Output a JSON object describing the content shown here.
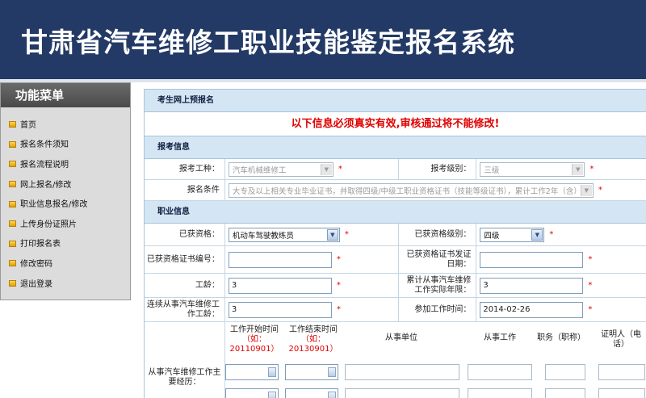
{
  "banner": {
    "title": "甘肃省汽车维修工职业技能鉴定报名系统"
  },
  "sidebar": {
    "title": "功能菜单",
    "items": [
      "首页",
      "报名条件须知",
      "报名流程说明",
      "网上报名/修改",
      "职业信息报名/修改",
      "上传身份证照片",
      "打印报名表",
      "修改密码",
      "退出登录"
    ]
  },
  "form": {
    "section_title": "考生网上预报名",
    "notice": "以下信息必须真实有效,审核通过将不能修改!",
    "exam_info": {
      "title": "报考信息",
      "job_label": "报考工种：",
      "job_value": "汽车机械维修工",
      "level_label": "报考级别：",
      "level_value": "三级",
      "condition_label": "报名条件",
      "condition_value": "大专及以上相关专业毕业证书，并取得四级/中级工职业资格证书（技能等级证书），累计工作2年（含）"
    },
    "job_info": {
      "title": "职业信息",
      "qual_label": "已获资格：",
      "qual_value": "机动车驾驶教练员",
      "qual_level_label": "已获资格级别：",
      "qual_level_value": "四级",
      "cert_no_label": "已获资格证书编号：",
      "cert_no_value": "",
      "cert_date_label": "已获资格证书发证日期：",
      "cert_date_value": "",
      "seniority_label": "工龄：",
      "seniority_value": "3",
      "years_label": "累计从事汽车维修工作实际年限：",
      "years_value": "3",
      "cont_years_label": "连续从事汽车维修工作工龄：",
      "cont_years_value": "3",
      "start_work_label": "参加工作时间：",
      "start_work_value": "2014-02-26"
    },
    "experience": {
      "label": "从事汽车维修工作主要经历：",
      "col_start": "工作开始时间",
      "col_start_hint": "（如：20110901）",
      "col_end": "工作结束时间",
      "col_end_hint": "（如：20130901）",
      "col_unit": "从事单位",
      "col_work": "从事工作",
      "col_post": "职务（职称）",
      "col_witness": "证明人（电话）"
    },
    "required_mark": "*"
  }
}
